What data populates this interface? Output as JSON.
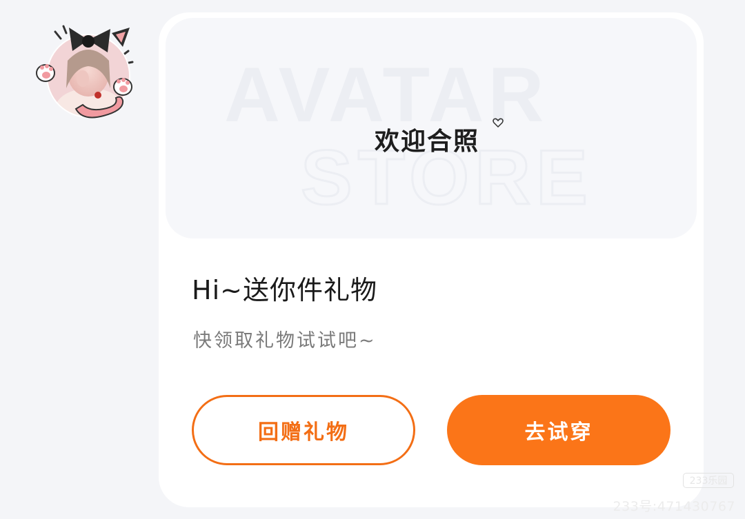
{
  "avatar": {
    "icon": "cat-ear-girl-avatar",
    "bow_color": "#2b2b2b",
    "tail_color": "#f19aa0"
  },
  "card": {
    "banner": {
      "watermark_line1": "AVATAR",
      "watermark_line2": "STORE",
      "caption": "欢迎合照"
    },
    "title": "Hi~送你件礼物",
    "subtitle": "快领取礼物试试吧~",
    "buttons": {
      "return_gift": "回赠礼物",
      "try_on": "去试穿"
    }
  },
  "watermark": {
    "logo": "233乐园",
    "id_text": "233号:471430767"
  },
  "colors": {
    "accent": "#fb7518",
    "outline": "#f36e15",
    "background": "#f4f5f8",
    "card": "#ffffff"
  }
}
